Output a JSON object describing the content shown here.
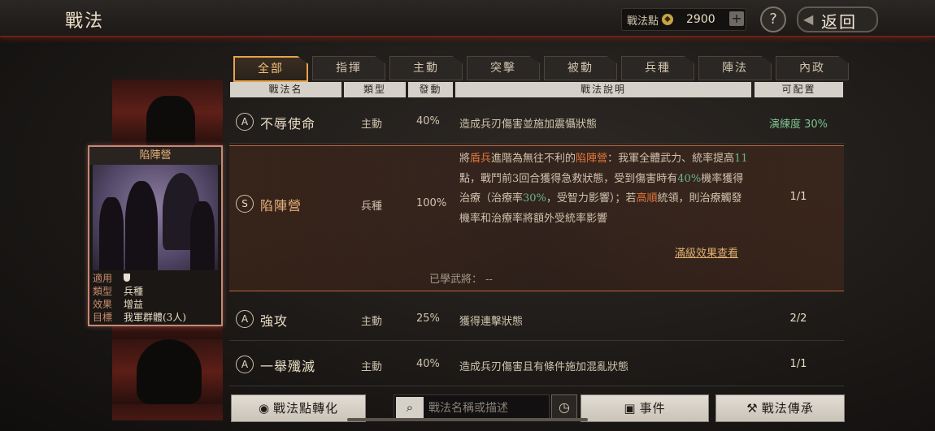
{
  "header": {
    "title": "戰法",
    "points_label": "戰法點",
    "points_value": "2900",
    "plus_icon": "+",
    "help_icon": "?",
    "back_label": "返回"
  },
  "card": {
    "name": "陷陣營",
    "stats": [
      {
        "key": "適用",
        "value": ""
      },
      {
        "key": "類型",
        "value": "兵種"
      },
      {
        "key": "效果",
        "value": "增益"
      },
      {
        "key": "目標",
        "value": "我軍群體(3人)"
      }
    ]
  },
  "tabs": [
    "全部",
    "指揮",
    "主動",
    "突擊",
    "被動",
    "兵種",
    "陣法",
    "內政"
  ],
  "active_tab": "全部",
  "columns": {
    "name": "戰法名",
    "type": "類型",
    "trigger": "發動",
    "desc": "戰法說明",
    "config": "可配置"
  },
  "rows": [
    {
      "grade": "A",
      "name": "不辱使命",
      "type": "主動",
      "pct": "40%",
      "desc": "造成兵刃傷害並施加震懾狀態",
      "slot": "演練度 30%"
    },
    {
      "grade": "S",
      "name": "陷陣營",
      "type": "兵種",
      "pct": "100%",
      "slot": "1/1",
      "desc_parts": [
        "將",
        "盾兵",
        "進階為無往不利的",
        "陷陣營",
        "：我軍全體武力、統率提高",
        "11",
        "點，戰鬥前3回合獲得急救狀態，受到傷害時有",
        "40%",
        "機率獲得治療（治療率",
        "30%",
        "，受智力影響）；若",
        "高順",
        "統領，則治療觸發機率和治療率將額外受統率影響"
      ],
      "more_label": "滿級效果查看",
      "learned_label": "已學武將：",
      "learned_value": "--"
    },
    {
      "grade": "A",
      "name": "強攻",
      "type": "主動",
      "pct": "25%",
      "desc": "獲得連擊狀態",
      "slot": "2/2"
    },
    {
      "grade": "A",
      "name": "一舉殲滅",
      "type": "主動",
      "pct": "40%",
      "desc": "造成兵刃傷害且有條件施加混亂狀態",
      "slot": "1/1"
    }
  ],
  "bottom": {
    "convert_label": "戰法點轉化",
    "search_placeholder": "戰法名稱或描述",
    "event_label": "事件",
    "inherit_label": "戰法傳承"
  },
  "colors": {
    "accent": "#e8a24a",
    "highlight_red": "#e0763a",
    "highlight_green": "#6ab58a",
    "slot_green": "#7fc48f"
  },
  "icons": [
    "coin-icon",
    "plus-icon",
    "help-icon",
    "back-arrow-icon",
    "shield-icon",
    "search-icon",
    "clock-icon",
    "convert-icon",
    "event-icon",
    "hammer-icon"
  ]
}
